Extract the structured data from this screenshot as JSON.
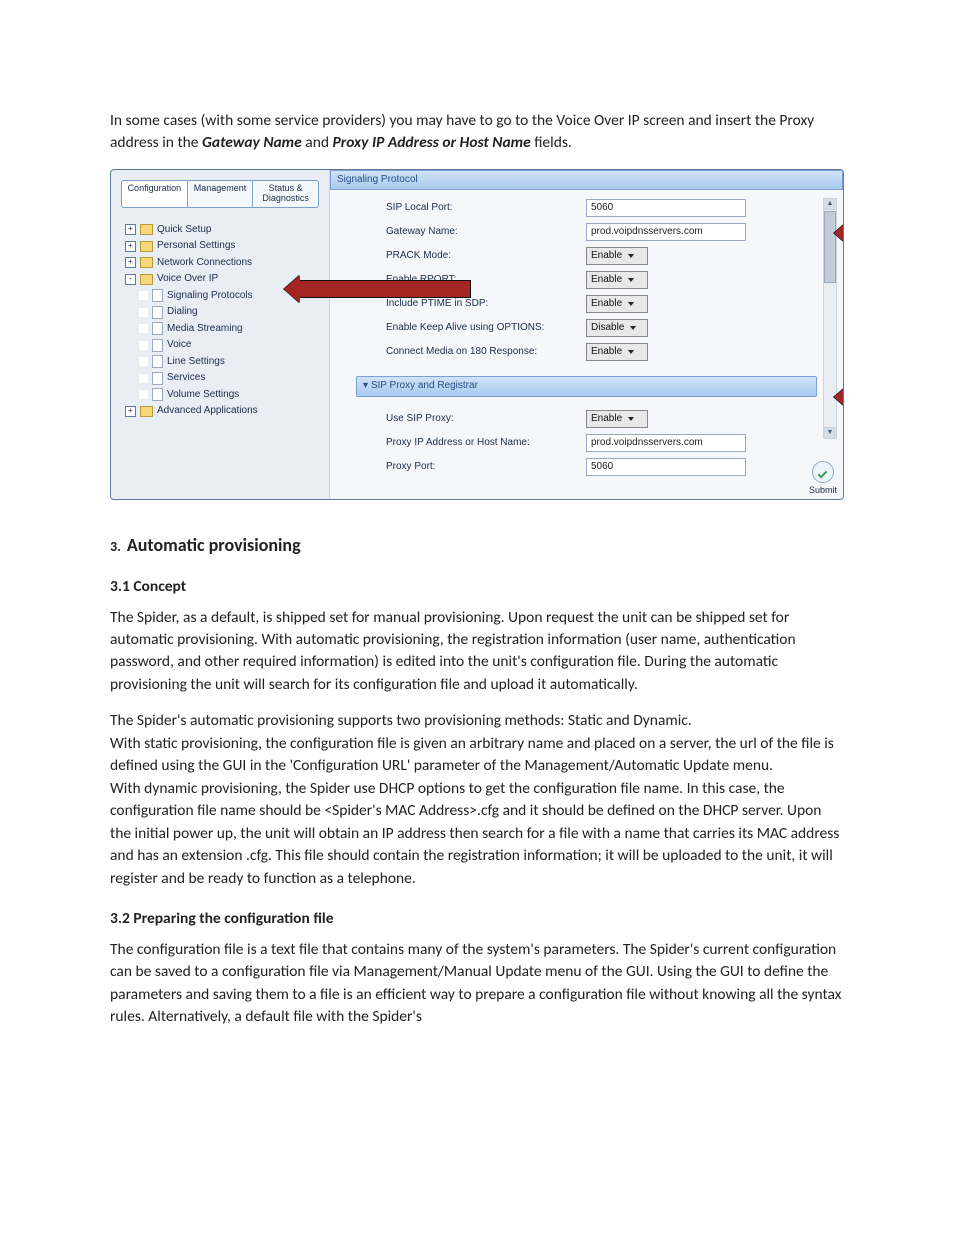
{
  "intro": {
    "pre": "In some cases (with some service providers) you may have to go to the Voice Over IP screen and insert the Proxy address in the ",
    "emph1": "Gateway Name",
    "mid": " and ",
    "emph2": "Proxy IP Address or Host Name",
    "post": " fields."
  },
  "screenshot": {
    "tabs": [
      "Configuration",
      "Management",
      "Status & Diagnostics"
    ],
    "tree": [
      {
        "level": 0,
        "expand": "+",
        "type": "folder",
        "label": "Quick Setup"
      },
      {
        "level": 0,
        "expand": "+",
        "type": "folder",
        "label": "Personal Settings"
      },
      {
        "level": 0,
        "expand": "+",
        "type": "folder",
        "label": "Network Connections"
      },
      {
        "level": 0,
        "expand": "-",
        "type": "folder",
        "label": "Voice Over IP"
      },
      {
        "level": 1,
        "expand": "",
        "type": "page",
        "label": "Signaling Protocols"
      },
      {
        "level": 1,
        "expand": "",
        "type": "page",
        "label": "Dialing"
      },
      {
        "level": 1,
        "expand": "",
        "type": "page",
        "label": "Media Streaming"
      },
      {
        "level": 1,
        "expand": "",
        "type": "page",
        "label": "Voice"
      },
      {
        "level": 1,
        "expand": "",
        "type": "page",
        "label": "Line Settings"
      },
      {
        "level": 1,
        "expand": "",
        "type": "page",
        "label": "Services"
      },
      {
        "level": 1,
        "expand": "",
        "type": "page",
        "label": "Volume Settings"
      },
      {
        "level": 0,
        "expand": "+",
        "type": "folder",
        "label": "Advanced Applications"
      }
    ],
    "panel_title": "Signaling Protocol",
    "fields_top": [
      {
        "label": "SIP Local Port:",
        "kind": "input",
        "value": "5060"
      },
      {
        "label": "Gateway Name:",
        "kind": "input",
        "value": "prod.voipdnsservers.com"
      },
      {
        "label": "PRACK Mode:",
        "kind": "select",
        "value": "Enable"
      },
      {
        "label": "Enable RPORT:",
        "kind": "select",
        "value": "Enable"
      },
      {
        "label": "Include PTIME in SDP:",
        "kind": "select",
        "value": "Enable"
      },
      {
        "label": "Enable Keep Alive using OPTIONS:",
        "kind": "select",
        "value": "Disable"
      },
      {
        "label": "Connect Media on 180 Response:",
        "kind": "select",
        "value": "Enable"
      }
    ],
    "sub_title": "SIP Proxy and Registrar",
    "fields_bottom": [
      {
        "label": "Use SIP Proxy:",
        "kind": "select",
        "value": "Enable"
      },
      {
        "label": "Proxy IP Address or Host Name:",
        "kind": "input",
        "value": "prod.voipdnsservers.com"
      },
      {
        "label": "Proxy Port:",
        "kind": "input",
        "value": "5060"
      }
    ],
    "submit": "Submit"
  },
  "sec3": {
    "num": "3.",
    "title": "Automatic provisioning",
    "h31": "3.1  Concept",
    "p1": "The Spider, as a default, is shipped set for manual provisioning. Upon request the unit can be shipped set for automatic provisioning. With automatic provisioning, the registration information (user name, authentication password, and other required information) is edited into the unit's configuration file. During the automatic provisioning the unit will search for its configuration file and upload it automatically.",
    "p2": "The Spider's automatic provisioning supports two provisioning methods: Static and Dynamic.",
    "p3": "With static provisioning, the configuration file is given an arbitrary name and placed on a server, the url of the file is defined using the GUI  in the 'Configuration URL' parameter of the Management/Automatic Update menu.",
    "p4": "With dynamic provisioning, the Spider use DHCP options to get the configuration file name. In this case, the configuration file name should be <Spider's MAC Address>.cfg and it should be defined on the DHCP server. Upon the initial power up, the unit will obtain an IP address then search for a file with a name that carries its MAC address and has an extension .cfg. This file should contain the registration information; it will be uploaded to the unit, it will register and be ready to function as a telephone.",
    "h32": "3.2 Preparing the configuration file",
    "p5": "The configuration file is a text file that contains many of the system's parameters. The Spider's current configuration can be saved to a configuration file via Management/Manual Update menu of the GUI. Using the GUI to define the parameters and saving them to a file is an efficient way to prepare a configuration file without knowing all the syntax rules. Alternatively, a default file with the Spider's"
  }
}
